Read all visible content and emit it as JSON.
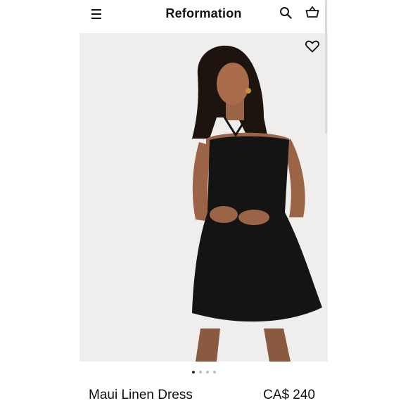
{
  "header": {
    "brand": "Reformation",
    "icons": {
      "menu": "hamburger-menu-icon",
      "search": "search-icon",
      "cart": "basket-icon"
    }
  },
  "gallery": {
    "favorite_icon": "heart-icon",
    "slide_count": 4,
    "active_slide": 1
  },
  "product": {
    "name": "Maui Linen Dress",
    "price": "CA$ 240"
  },
  "colors": {
    "background": "#ffffff",
    "photo_background": "#efeeec",
    "dress": "#141414",
    "dot_active": "#333333",
    "dot_inactive": "#bdbdbd"
  }
}
